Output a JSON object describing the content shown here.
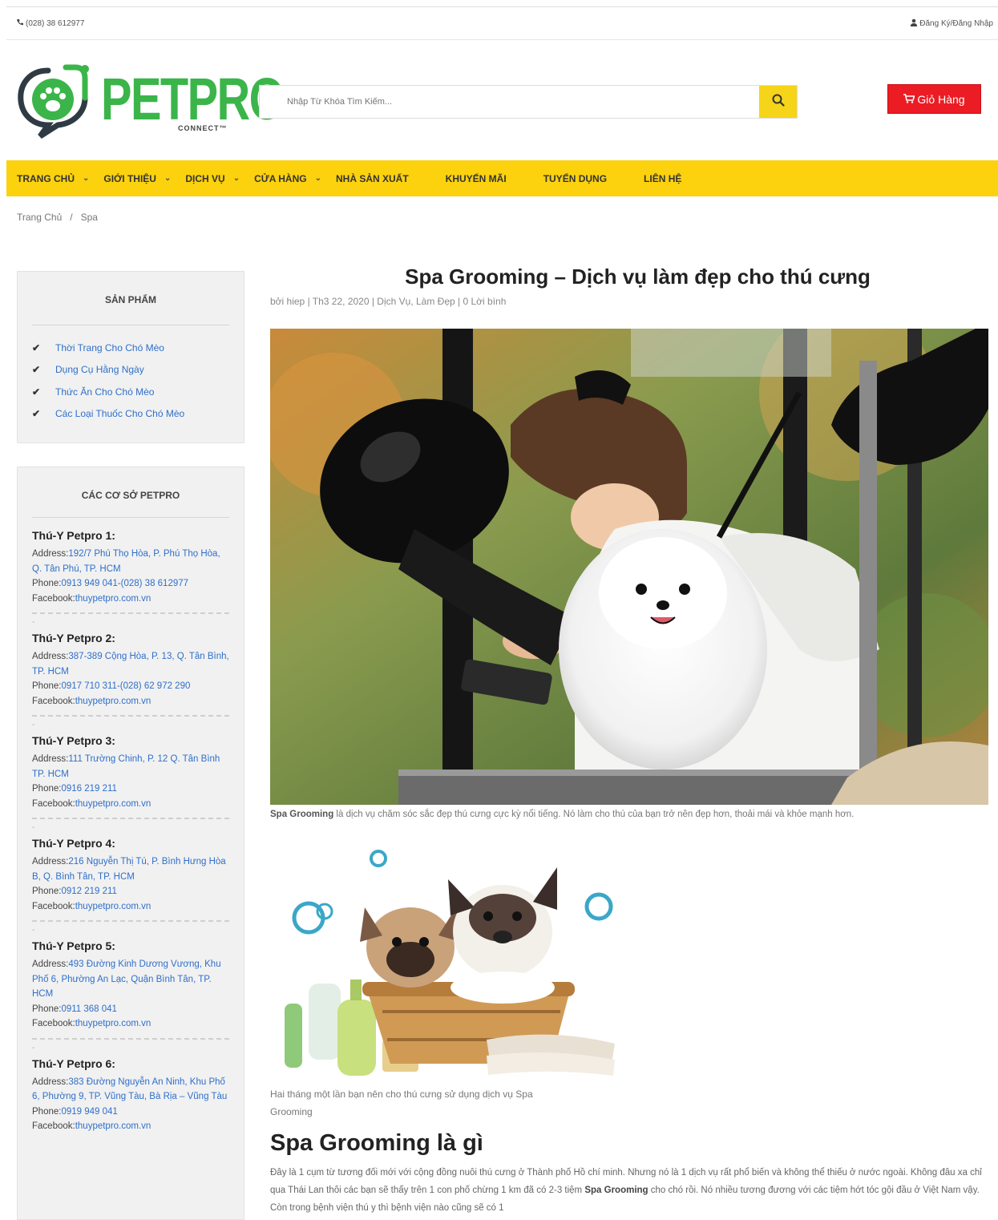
{
  "topbar": {
    "phone": "(028) 38 612977",
    "account": "Đăng Ký/Đăng Nhập"
  },
  "logo": {
    "main": "PETPRO",
    "sub": "CONNECT™"
  },
  "search": {
    "placeholder": "Nhập Từ Khóa Tìm Kiếm..."
  },
  "cart": {
    "label": "Giỏ Hàng"
  },
  "nav": {
    "items": [
      {
        "label": "TRANG CHỦ"
      },
      {
        "label": "GIỚI THIỆU"
      },
      {
        "label": "DỊCH VỤ"
      },
      {
        "label": "CỬA HÀNG"
      },
      {
        "label": "NHÀ SẢN XUẤT"
      },
      {
        "label": "KHUYẾN MÃI"
      },
      {
        "label": "TUYỂN DỤNG"
      },
      {
        "label": "LIÊN HỆ"
      }
    ]
  },
  "breadcrumb": {
    "home": "Trang Chủ",
    "sep": "/",
    "current": "Spa"
  },
  "products": {
    "title": "SẢN PHẨM",
    "items": [
      "Thời Trang Cho Chó Mèo",
      "Dụng Cụ Hằng Ngày",
      "Thức Ăn Cho Chó Mèo",
      "Các Loại Thuốc Cho Chó Mèo"
    ]
  },
  "branches": {
    "title": "CÁC CƠ SỞ PETPRO",
    "labels": {
      "address": "Address:",
      "phone": "Phone:",
      "facebook": "Facebook:"
    },
    "tick": "-",
    "list": [
      {
        "name": "Thú-Y Petpro 1:",
        "address": "192/7 Phú Thọ Hòa, P. Phú Thọ Hòa, Q. Tân Phú, TP. HCM",
        "phone": "0913 949 041-(028) 38 612977",
        "facebook": "thuypetpro.com.vn"
      },
      {
        "name": "Thú-Y Petpro 2:",
        "address": "387-389 Cộng Hòa, P. 13, Q. Tân Bình, TP. HCM",
        "phone": "0917 710 311-(028) 62 972 290",
        "facebook": "thuypetpro.com.vn"
      },
      {
        "name": "Thú-Y Petpro 3:",
        "address": "111 Trường Chinh, P. 12 Q. Tân Bình TP. HCM",
        "phone": "0916 219 211",
        "facebook": "thuypetpro.com.vn"
      },
      {
        "name": "Thú-Y Petpro 4:",
        "address": "216 Nguyễn Thị Tú, P. Bình Hưng Hòa B, Q. Bình Tân, TP. HCM",
        "phone": "0912 219 211",
        "facebook": "thuypetpro.com.vn"
      },
      {
        "name": "Thú-Y Petpro 5:",
        "address": "493 Đường Kinh Dương Vương, Khu Phố 6, Phường An Lạc, Quận Bình Tân, TP. HCM",
        "phone": "0911 368 041",
        "facebook": "thuypetpro.com.vn"
      },
      {
        "name": "Thú-Y Petpro 6:",
        "address": "383 Đường Nguyễn An Ninh, Khu Phố 6, Phường 9, TP. Vũng Tàu, Bà Rịa – Vũng Tàu",
        "phone": "0919 949 041",
        "facebook": "thuypetpro.com.vn"
      }
    ]
  },
  "article": {
    "title": "Spa Grooming – Dịch vụ làm đẹp cho thú cưng",
    "meta": "bởi hiep | Th3 22, 2020 | Dịch Vụ, Làm Đẹp | 0 Lời bình",
    "caption1_bold": "Spa Grooming",
    "caption1_rest": " là dịch vụ chăm sóc sắc đẹp thú cưng cực kỳ nổi tiếng. Nó làm cho thú của bạn trở nên đẹp hơn, thoải mái và khỏe mạnh hơn.",
    "caption2": "Hai tháng một lần bạn nên cho thú cưng sử dụng dịch vụ Spa Grooming",
    "h2": "Spa Grooming là gì",
    "para_a": "Đây là 1 cụm từ tương đối mới với cộng đồng nuôi thú cưng ở Thành phố Hồ chí minh. Nhưng nó là 1 dịch vụ rất phổ biến và không thể thiếu ở nước ngoài. Không đâu xa chỉ qua Thái Lan thôi các bạn sẽ thấy trên 1 con phố chừng 1 km đã có 2-3 tiệm ",
    "para_bold": "Spa Grooming",
    "para_b": " cho chó rồi. Nó nhiều tương đương với các tiệm hớt tóc gội đầu ở Việt Nam vậy. Còn trong bệnh viện thú y thì bệnh viện nào cũng sẽ có 1"
  },
  "colors": {
    "brand_green": "#3bb54a",
    "nav_yellow": "#fbd20d",
    "cart_red": "#ec1c24",
    "link_blue": "#2f6fc9"
  }
}
